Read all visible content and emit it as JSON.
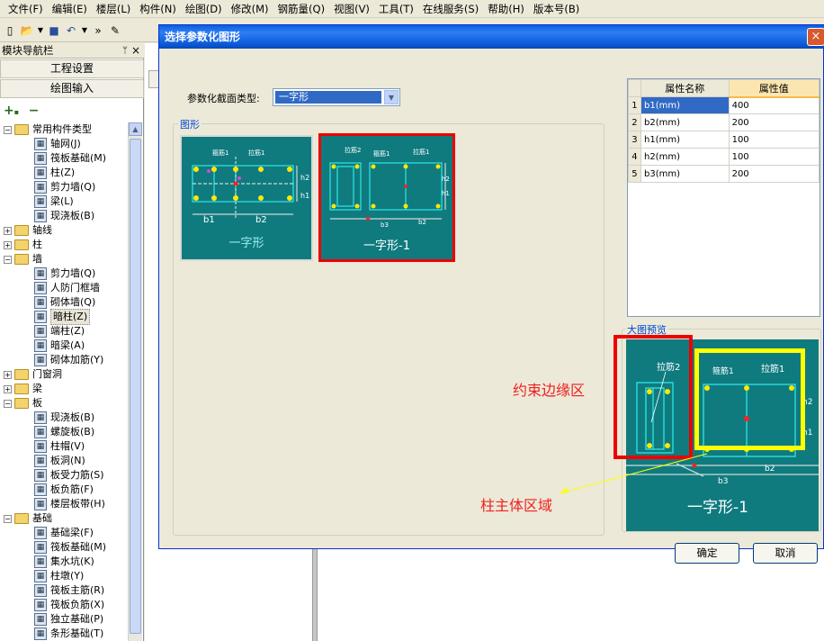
{
  "menu": [
    "文件(F)",
    "编辑(E)",
    "楼层(L)",
    "构件(N)",
    "绘图(D)",
    "修改(M)",
    "钢筋量(Q)",
    "视图(V)",
    "工具(T)",
    "在线服务(S)",
    "帮助(H)",
    "版本号(B)"
  ],
  "nav": {
    "title": "模块导航栏",
    "pin": "ᛘ",
    "close": "×",
    "btn_project": "工程设置",
    "btn_draw": "绘图输入",
    "tools": "+ −",
    "tree": [
      {
        "level": 0,
        "type": "folder",
        "exp": "−",
        "label": "常用构件类型"
      },
      {
        "level": 1,
        "type": "leaf",
        "label": "轴网(J)"
      },
      {
        "level": 1,
        "type": "leaf",
        "label": "筏板基础(M)"
      },
      {
        "level": 1,
        "type": "leaf",
        "label": "柱(Z)"
      },
      {
        "level": 1,
        "type": "leaf",
        "label": "剪力墙(Q)"
      },
      {
        "level": 1,
        "type": "leaf",
        "label": "梁(L)"
      },
      {
        "level": 1,
        "type": "leaf",
        "label": "现浇板(B)"
      },
      {
        "level": 0,
        "type": "folder",
        "exp": "+",
        "label": "轴线"
      },
      {
        "level": 0,
        "type": "folder",
        "exp": "+",
        "label": "柱"
      },
      {
        "level": 0,
        "type": "folder",
        "exp": "−",
        "label": "墙"
      },
      {
        "level": 1,
        "type": "leaf",
        "label": "剪力墙(Q)"
      },
      {
        "level": 1,
        "type": "leaf",
        "label": "人防门框墙"
      },
      {
        "level": 1,
        "type": "leaf",
        "label": "砌体墙(Q)"
      },
      {
        "level": 1,
        "type": "leaf",
        "label": "暗柱(Z)",
        "selected": true
      },
      {
        "level": 1,
        "type": "leaf",
        "label": "端柱(Z)"
      },
      {
        "level": 1,
        "type": "leaf",
        "label": "暗梁(A)"
      },
      {
        "level": 1,
        "type": "leaf",
        "label": "砌体加筋(Y)"
      },
      {
        "level": 0,
        "type": "folder",
        "exp": "+",
        "label": "门窗洞"
      },
      {
        "level": 0,
        "type": "folder",
        "exp": "+",
        "label": "梁"
      },
      {
        "level": 0,
        "type": "folder",
        "exp": "−",
        "label": "板"
      },
      {
        "level": 1,
        "type": "leaf",
        "label": "现浇板(B)"
      },
      {
        "level": 1,
        "type": "leaf",
        "label": "螺旋板(B)"
      },
      {
        "level": 1,
        "type": "leaf",
        "label": "柱帽(V)"
      },
      {
        "level": 1,
        "type": "leaf",
        "label": "板洞(N)"
      },
      {
        "level": 1,
        "type": "leaf",
        "label": "板受力筋(S)"
      },
      {
        "level": 1,
        "type": "leaf",
        "label": "板负筋(F)"
      },
      {
        "level": 1,
        "type": "leaf",
        "label": "楼层板带(H)"
      },
      {
        "level": 0,
        "type": "folder",
        "exp": "−",
        "label": "基础"
      },
      {
        "level": 1,
        "type": "leaf",
        "label": "基础梁(F)"
      },
      {
        "level": 1,
        "type": "leaf",
        "label": "筏板基础(M)"
      },
      {
        "level": 1,
        "type": "leaf",
        "label": "集水坑(K)"
      },
      {
        "level": 1,
        "type": "leaf",
        "label": "柱墩(Y)"
      },
      {
        "level": 1,
        "type": "leaf",
        "label": "筏板主筋(R)"
      },
      {
        "level": 1,
        "type": "leaf",
        "label": "筏板负筋(X)"
      },
      {
        "level": 1,
        "type": "leaf",
        "label": "独立基础(P)"
      },
      {
        "level": 1,
        "type": "leaf",
        "label": "条形基础(T)"
      }
    ]
  },
  "dialog": {
    "title": "选择参数化图形",
    "close": "×",
    "type_label": "参数化截面类型:",
    "type_value": "一字形",
    "shapes_group": "图形",
    "preview_group": "大图预览",
    "ok": "确定",
    "cancel": "取消",
    "thumb1": {
      "caption": "一字形",
      "l1": "箍筋1",
      "l2": "拉筋1",
      "b1": "b1",
      "b2": "b2",
      "h1": "h1",
      "h2": "h2"
    },
    "thumb2": {
      "caption": "一字形-1",
      "l1": "拉筋2",
      "l2": "箍筋1",
      "l3": "拉筋1",
      "b3": "b3",
      "b2": "b2",
      "h1": "h1",
      "h2": "h2"
    },
    "preview": {
      "caption": "一字形-1",
      "l1": "拉筋2",
      "l2": "箍筋1",
      "l3": "拉筋1",
      "b3": "b3",
      "b2": "b2",
      "h1": "h1",
      "h2": "h2"
    },
    "prop_headers": [
      "属性名称",
      "属性值"
    ],
    "props": [
      {
        "n": "1",
        "name": "b1(mm)",
        "value": "400"
      },
      {
        "n": "2",
        "name": "b2(mm)",
        "value": "200"
      },
      {
        "n": "3",
        "name": "h1(mm)",
        "value": "100"
      },
      {
        "n": "4",
        "name": "h2(mm)",
        "value": "100"
      },
      {
        "n": "5",
        "name": "b3(mm)",
        "value": "200"
      }
    ]
  },
  "annotations": {
    "edge_zone": "约束边缘区",
    "main_zone": "柱主体区域"
  },
  "colors": {
    "accent_red": "#ee0000",
    "accent_yellow": "#ffff00",
    "diagram_teal": "#0f7b7f",
    "title_blue": "#0a5ede"
  }
}
